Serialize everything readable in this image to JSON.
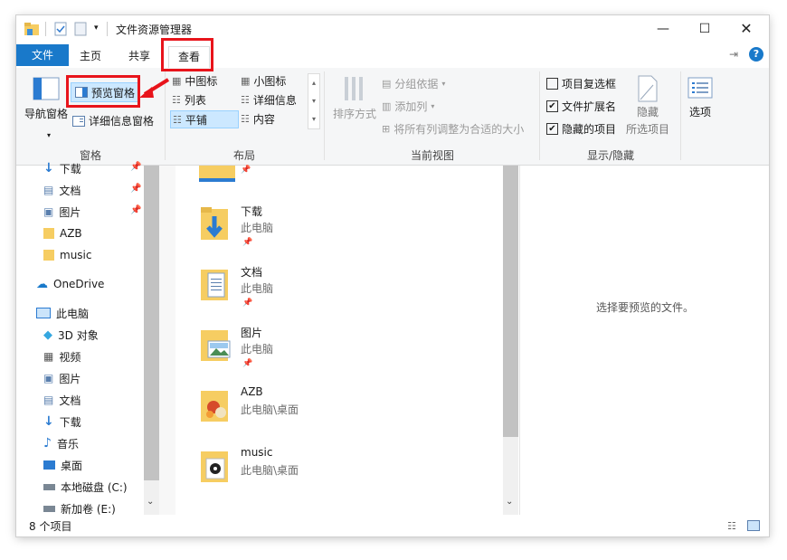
{
  "window": {
    "title": "文件资源管理器"
  },
  "tabs": {
    "file": "文件",
    "home": "主页",
    "share": "共享",
    "view": "查看"
  },
  "ribbon": {
    "panes": {
      "nav_pane": "导航窗格",
      "preview_pane": "预览窗格",
      "details_pane": "详细信息窗格",
      "label": "窗格"
    },
    "layout": {
      "medium_icons": "中图标",
      "small_icons": "小图标",
      "list": "列表",
      "details": "详细信息",
      "tiles": "平铺",
      "content": "内容",
      "label": "布局"
    },
    "current_view": {
      "sort_by": "排序方式",
      "group_by": "分组依据",
      "add_columns": "添加列",
      "size_all_columns": "将所有列调整为合适的大小",
      "label": "当前视图"
    },
    "show_hide": {
      "item_checkboxes": "项目复选框",
      "file_extensions": "文件扩展名",
      "hidden_items": "隐藏的项目",
      "hide_selected_line1": "隐藏",
      "hide_selected_line2": "所选项目",
      "label": "显示/隐藏",
      "item_checkboxes_checked": false,
      "file_extensions_checked": true,
      "hidden_items_checked": true
    },
    "options": "选项"
  },
  "sidebar": {
    "items": [
      {
        "label": "下载"
      },
      {
        "label": "文档"
      },
      {
        "label": "图片"
      },
      {
        "label": "AZB"
      },
      {
        "label": "music"
      },
      {
        "label": "OneDrive"
      },
      {
        "label": "此电脑"
      },
      {
        "label": "3D 对象"
      },
      {
        "label": "视频"
      },
      {
        "label": "图片"
      },
      {
        "label": "文档"
      },
      {
        "label": "下载"
      },
      {
        "label": "音乐"
      },
      {
        "label": "桌面"
      },
      {
        "label": "本地磁盘 (C:)"
      },
      {
        "label": "新加卷 (E:)"
      }
    ]
  },
  "files": [
    {
      "name": "下载",
      "location": "此电脑",
      "pinned": true
    },
    {
      "name": "文档",
      "location": "此电脑",
      "pinned": true
    },
    {
      "name": "图片",
      "location": "此电脑",
      "pinned": true
    },
    {
      "name": "AZB",
      "location": "此电脑\\桌面",
      "pinned": false
    },
    {
      "name": "music",
      "location": "此电脑\\桌面",
      "pinned": false
    }
  ],
  "preview": {
    "message": "选择要预览的文件。"
  },
  "status": {
    "item_count": "8 个项目"
  },
  "colors": {
    "accent": "#1979ca",
    "highlight": "#e8141b",
    "selected": "#cce8ff",
    "folder": "#f6cd62"
  }
}
